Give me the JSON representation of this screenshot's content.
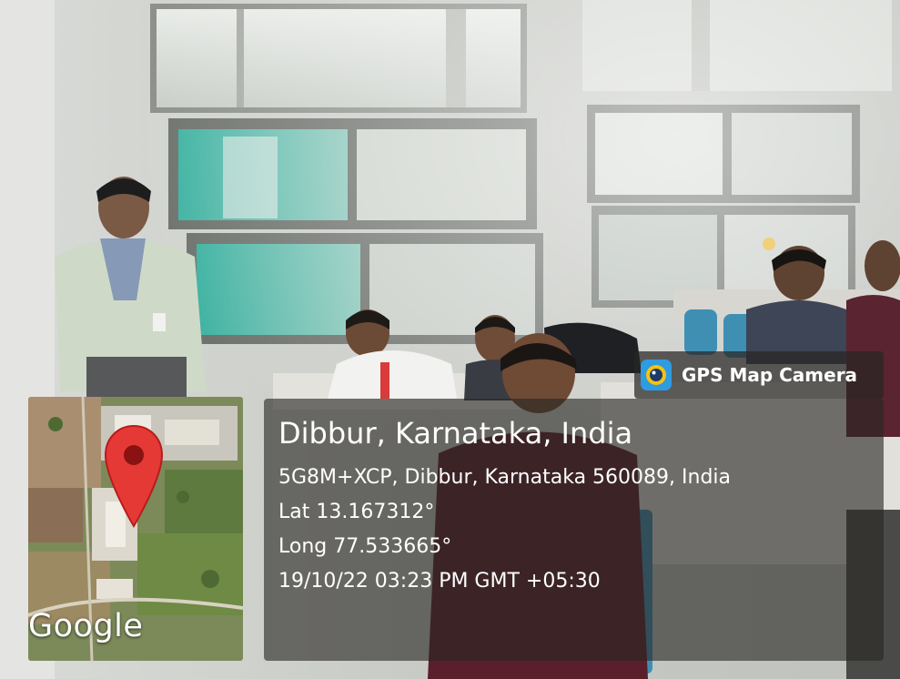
{
  "overlay": {
    "brand": {
      "label": "GPS Map Camera",
      "icon": "camera-lens-icon"
    },
    "location": {
      "place": "Dibbur, Karnataka, India",
      "address": "5G8M+XCP, Dibbur, Karnataka 560089, India",
      "latitude": "Lat 13.167312°",
      "longitude": "Long 77.533665°",
      "timestamp": "19/10/22 03:23 PM GMT +05:30"
    },
    "map": {
      "logo": "Google",
      "marker_icon": "map-pin-icon"
    }
  },
  "colors": {
    "panel_bg": "#2a2826",
    "marker_red": "#e53935",
    "text": "#ffffff"
  }
}
